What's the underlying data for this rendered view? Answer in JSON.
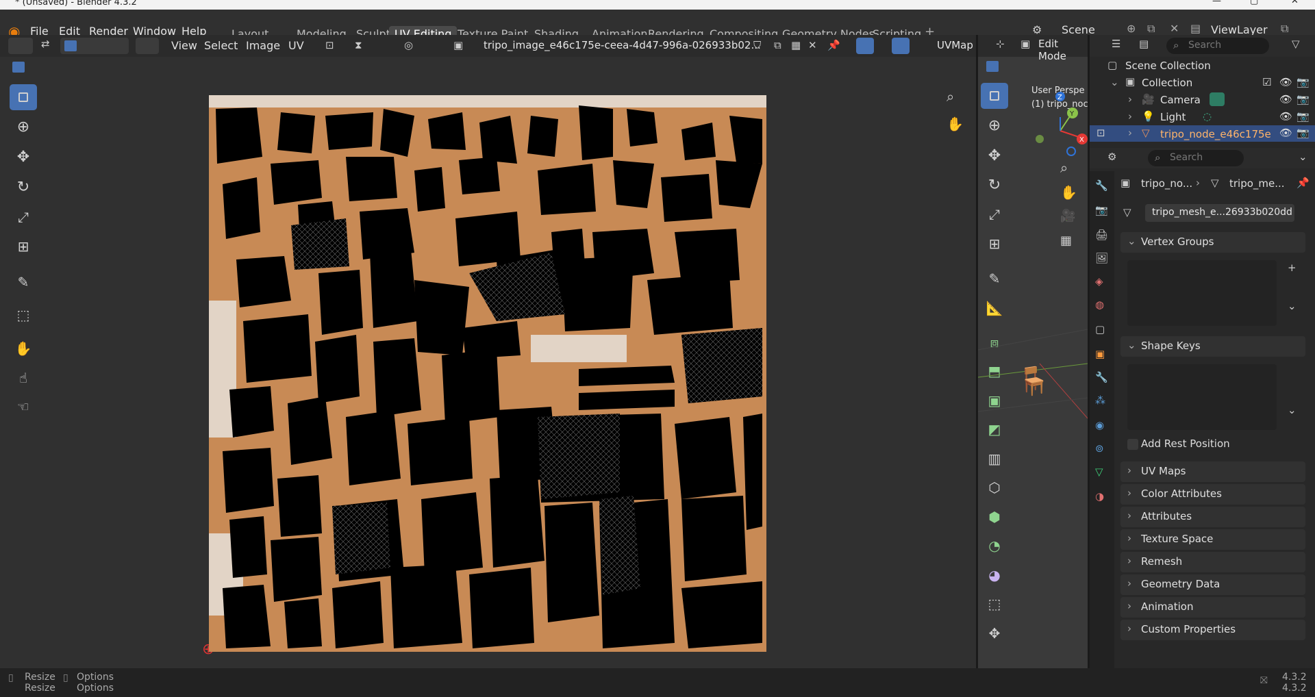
{
  "window": {
    "title": "* (Unsaved) - Blender 4.3.2"
  },
  "menu": [
    "File",
    "Edit",
    "Render",
    "Window",
    "Help"
  ],
  "workspaces": [
    "Layout",
    "Modeling",
    "Sculpting",
    "UV Editing",
    "Texture Paint",
    "Shading",
    "Animation",
    "Rendering",
    "Compositing",
    "Geometry Nodes",
    "Scripting"
  ],
  "active_workspace": "UV Editing",
  "scene": {
    "label": "Scene",
    "view_layer": "ViewLayer"
  },
  "uv_editor": {
    "menus": [
      "View",
      "Select",
      "Image",
      "UV"
    ],
    "image_name": "tripo_image_e46c175e-ceea-4d47-996a-026933b02...",
    "uvmap_label": "UVMap"
  },
  "viewport3d": {
    "mode": "Edit Mode",
    "overlay_text_1": "User Perspe",
    "overlay_text_2": "(1) tripo_noc",
    "gizmo": {
      "z": "Z",
      "y": "Y",
      "x": "X"
    }
  },
  "outliner": {
    "search_placeholder": "Search",
    "root": "Scene Collection",
    "collection": "Collection",
    "items": [
      "Camera",
      "Light",
      "tripo_node_e46c175e"
    ]
  },
  "properties": {
    "search_placeholder": "Search",
    "breadcrumb": [
      "tripo_no...",
      "tripo_me..."
    ],
    "mesh_name": "tripo_mesh_e...26933b020dd",
    "panels_open": [
      "Vertex Groups",
      "Shape Keys"
    ],
    "add_rest_position": "Add Rest Position",
    "panels_closed": [
      "UV Maps",
      "Color Attributes",
      "Attributes",
      "Texture Space",
      "Remesh",
      "Geometry Data",
      "Animation",
      "Custom Properties"
    ]
  },
  "statusbar": {
    "items": [
      "Resize",
      "Options"
    ],
    "version": "4.3.2"
  },
  "colors": {
    "accent": "#4772b3",
    "texture_orange": "#c88a55",
    "selected_row": "#334d80"
  }
}
